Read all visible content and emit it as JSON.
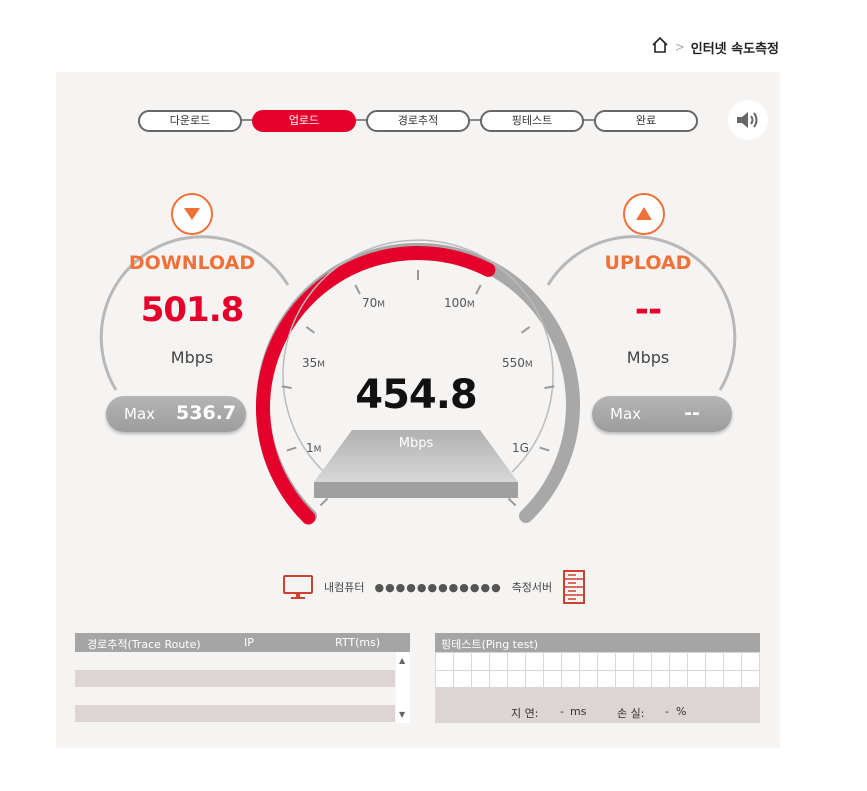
{
  "breadcrumb": {
    "page": "인터넷 속도측정"
  },
  "steps": [
    "다운로드",
    "업로드",
    "경로추적",
    "핑테스트",
    "완료"
  ],
  "active_step": 1,
  "download": {
    "title": "DOWNLOAD",
    "value": "501.8",
    "unit": "Mbps",
    "max_label": "Max",
    "max_value": "536.7"
  },
  "upload": {
    "title": "UPLOAD",
    "value": "--",
    "unit": "Mbps",
    "max_label": "Max",
    "max_value": "--"
  },
  "gauge": {
    "value": "454.8",
    "unit": "Mbps",
    "ticks": [
      {
        "num": "1",
        "suffix": "M"
      },
      {
        "num": "35",
        "suffix": "M"
      },
      {
        "num": "70",
        "suffix": "M"
      },
      {
        "num": "100",
        "suffix": "M"
      },
      {
        "num": "550",
        "suffix": "M"
      },
      {
        "num": "1G",
        "suffix": ""
      }
    ],
    "fill_fraction": 0.6
  },
  "connection": {
    "client": "내컴퓨터",
    "server": "측정서버",
    "dots": "●●●●●●●●●●●●"
  },
  "trace": {
    "col1": "경로추적(Trace Route)",
    "col2": "IP",
    "col3": "RTT(ms)"
  },
  "ping": {
    "title": "핑테스트(Ping test)",
    "latency_label": "지 연:",
    "latency_value": "-",
    "latency_unit": "ms",
    "loss_label": "손 실:",
    "loss_value": "-",
    "loss_unit": "%"
  },
  "colors": {
    "accent": "#e4002b",
    "orange": "#f07138",
    "gray": "#a5a5a5"
  }
}
